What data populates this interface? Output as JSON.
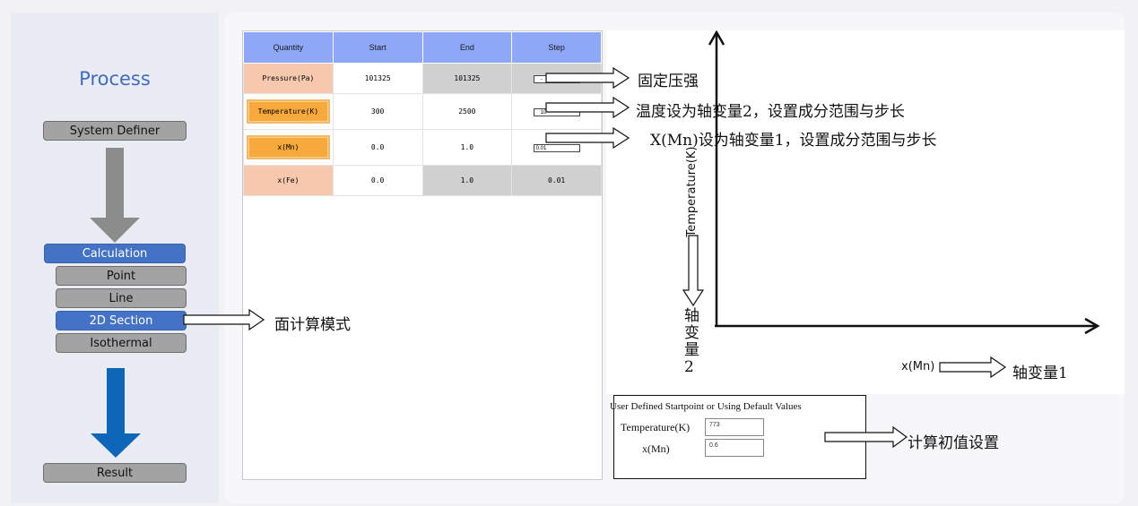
{
  "sidebar": {
    "title": "Process",
    "system_definer": "System Definer",
    "calculation": "Calculation",
    "point": "Point",
    "line": "Line",
    "section2d": "2D Section",
    "isothermal": "Isothermal",
    "result": "Result",
    "arrow_colors": {
      "top": "#8c8c8c",
      "bottom": "#0e66b8"
    }
  },
  "table": {
    "headers": [
      "Quantity",
      "Start",
      "End",
      "Step"
    ],
    "rows": [
      {
        "quantity": "Pressure(Pa)",
        "start": "101325",
        "end": "101325",
        "step": "-"
      },
      {
        "quantity": "Temperature(K)",
        "start": "300",
        "end": "2500",
        "step": "10"
      },
      {
        "quantity": "x(Mn)",
        "start": "0.0",
        "end": "1.0",
        "step": "0.01"
      },
      {
        "quantity": "x(Fe)",
        "start": "0.0",
        "end": "1.0",
        "step": "0.01"
      }
    ]
  },
  "annotations": {
    "fixed_pressure": "固定压强",
    "temp_axis2": "温度设为轴变量2，设置成分范围与步长",
    "xmn_axis1": "X(Mn)设为轴变量1，设置成分范围与步长",
    "mode": "面计算模式",
    "axis_var2": "轴变量2",
    "axis_var1": "轴变量1",
    "init_setting": "计算初值设置"
  },
  "plot": {
    "ylabel": "Temperature(K)",
    "xlabel": "x(Mn)"
  },
  "start_point": {
    "title": "User Defined Startpoint or Using Default Values",
    "temp_label": "Temperature(K)",
    "temp_value": "773",
    "xmn_label": "x(Mn)",
    "xmn_value": "0.6"
  },
  "colors": {
    "accent": "#4472c4",
    "header": "#8ea8f7",
    "pink": "#f6c8ad",
    "orange": "#f7a93b"
  }
}
